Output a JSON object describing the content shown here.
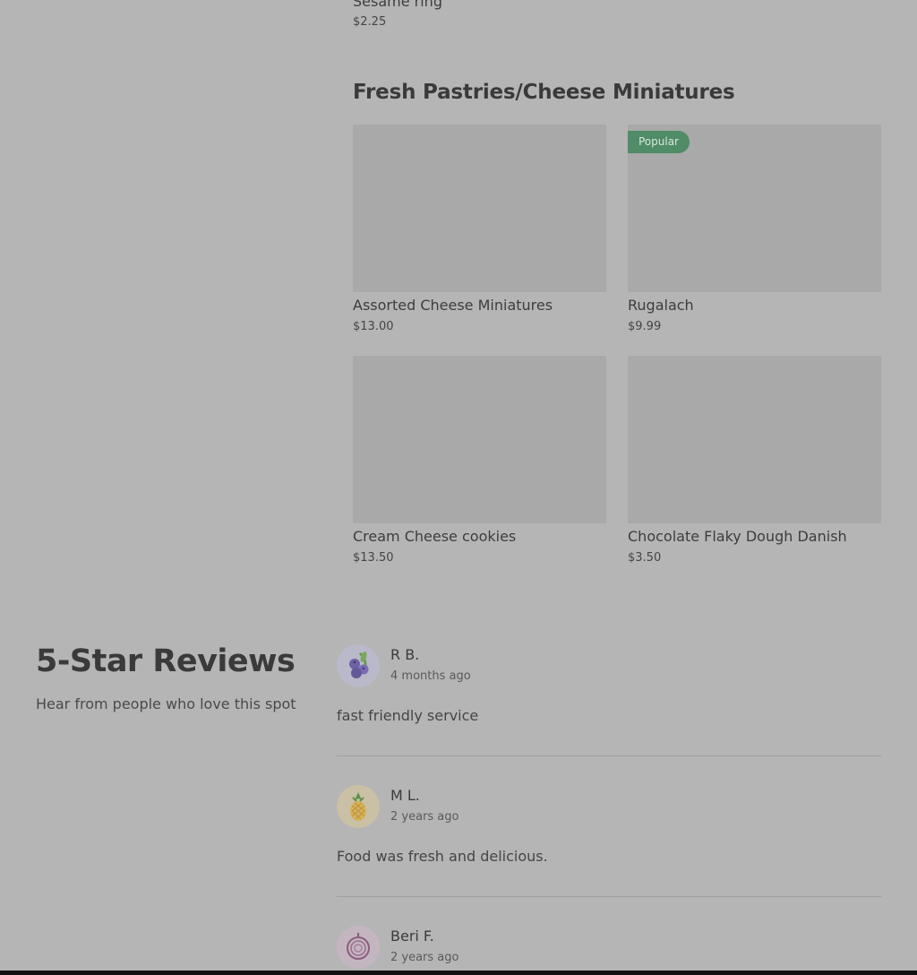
{
  "previous_item": {
    "name": "Sesame ring",
    "price": "$2.25"
  },
  "section": {
    "title": "Fresh Pastries/Cheese Miniatures",
    "items": [
      {
        "name": "Assorted Cheese Miniatures",
        "price": "$13.00",
        "badge": ""
      },
      {
        "name": "Rugalach",
        "price": "$9.99",
        "badge": "Popular"
      },
      {
        "name": "Cream Cheese cookies",
        "price": "$13.50",
        "badge": ""
      },
      {
        "name": "Chocolate Flaky Dough Danish",
        "price": "$3.50",
        "badge": ""
      }
    ]
  },
  "reviews": {
    "title": "5-Star Reviews",
    "subtitle": "Hear from people who love this spot",
    "items": [
      {
        "name": "R B.",
        "date": "4 months ago",
        "text": "fast friendly service",
        "avatar_icon": "blueberry-icon",
        "avatar_bg": "#b9b9c9"
      },
      {
        "name": "M L.",
        "date": "2 years ago",
        "text": "Food was fresh and delicious.",
        "avatar_icon": "pineapple-icon",
        "avatar_bg": "#c9c0a6"
      },
      {
        "name": "Beri F.",
        "date": "2 years ago",
        "text": "",
        "avatar_icon": "onion-icon",
        "avatar_bg": "#c4b6c0"
      }
    ]
  },
  "colors": {
    "badge": "#4f8c67",
    "background": "#b5b5b5",
    "image_placeholder": "#a9a9a9"
  }
}
